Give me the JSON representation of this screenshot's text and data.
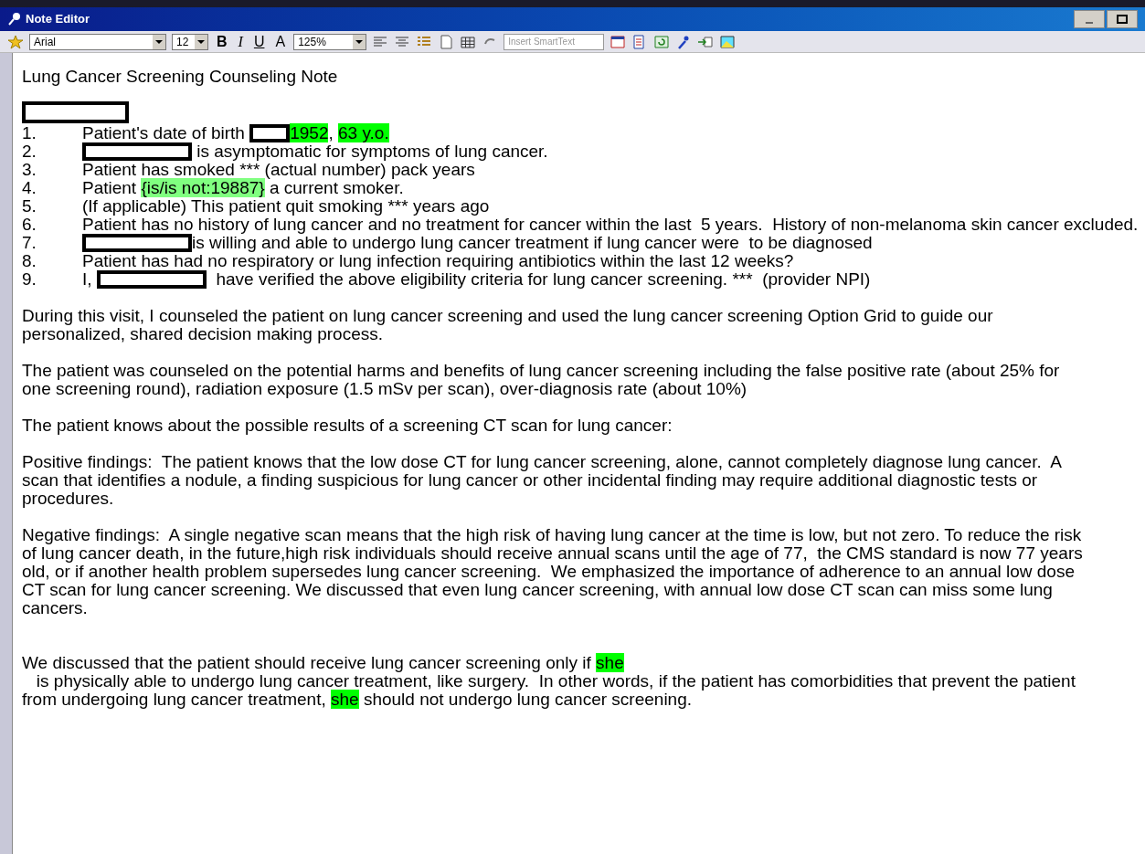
{
  "window": {
    "title": "Note Editor"
  },
  "toolbar": {
    "font": "Arial",
    "size": "12",
    "format_buttons": [
      "B",
      "I",
      "U",
      "A"
    ],
    "zoom": "125%",
    "smarttext_placeholder": "Insert SmartText"
  },
  "document": {
    "title": "Lung Cancer Screening Counseling Note",
    "items": [
      {
        "number": "1.",
        "segments": [
          {
            "kind": "text",
            "text": "Patient's date of birth "
          },
          {
            "kind": "redacted"
          },
          {
            "kind": "highlight",
            "text": "1952",
            "color": "#00ff00"
          },
          {
            "kind": "text",
            "text": ", "
          },
          {
            "kind": "highlight",
            "text": "63 y.o.",
            "color": "#00ff00"
          }
        ]
      },
      {
        "number": "2.",
        "segments": [
          {
            "kind": "redacted"
          },
          {
            "kind": "text",
            "text": " is asymptomatic for symptoms of lung cancer."
          }
        ]
      },
      {
        "number": "3.",
        "segments": [
          {
            "kind": "text",
            "text": "Patient has smoked *** (actual number) pack years"
          }
        ]
      },
      {
        "number": "4.",
        "segments": [
          {
            "kind": "text",
            "text": "Patient "
          },
          {
            "kind": "highlight",
            "text": "{is/is not:19887}",
            "color": "#80ff80"
          },
          {
            "kind": "text",
            "text": " a current smoker."
          }
        ]
      },
      {
        "number": "5.",
        "segments": [
          {
            "kind": "text",
            "text": "(If applicable) This patient quit smoking *** years ago"
          }
        ]
      },
      {
        "number": "6.",
        "segments": [
          {
            "kind": "text",
            "text": "Patient has no history of lung cancer and no treatment for cancer within the last  5 years.  History of non-melanoma skin cancer excluded."
          }
        ]
      },
      {
        "number": "7.",
        "segments": [
          {
            "kind": "redacted"
          },
          {
            "kind": "text",
            "text": "is willing and able to undergo lung cancer treatment if lung cancer were  to be diagnosed"
          }
        ]
      },
      {
        "number": "8.",
        "segments": [
          {
            "kind": "text",
            "text": "Patient has had no respiratory or lung infection requiring antibiotics within the last 12 weeks?"
          }
        ]
      },
      {
        "number": "9.",
        "segments": [
          {
            "kind": "text",
            "text": "I, "
          },
          {
            "kind": "redacted"
          },
          {
            "kind": "text",
            "text": "  have verified the above eligibility criteria for lung cancer screening. ***  (provider NPI)"
          }
        ]
      }
    ],
    "paragraphs": [
      {
        "lines": [
          [
            {
              "kind": "text",
              "text": "During this visit, I counseled the patient on lung cancer screening and used the lung cancer screening Option Grid to guide our"
            }
          ],
          [
            {
              "kind": "text",
              "text": "personalized, shared decision making process."
            }
          ]
        ]
      },
      {
        "lines": [
          [
            {
              "kind": "text",
              "text": "The patient was counseled on the potential harms and benefits of lung cancer screening including the false positive rate (about 25% for"
            }
          ],
          [
            {
              "kind": "text",
              "text": "one screening round), radiation exposure (1.5 mSv per scan), over-diagnosis rate (about 10%)"
            }
          ]
        ]
      },
      {
        "lines": [
          [
            {
              "kind": "text",
              "text": "The patient knows about the possible results of a screening CT scan for lung cancer:"
            }
          ]
        ]
      },
      {
        "lines": [
          [
            {
              "kind": "text",
              "text": "Positive findings:  The patient knows that the low dose CT for lung cancer screening, alone, cannot completely diagnose lung cancer.  A"
            }
          ],
          [
            {
              "kind": "text",
              "text": "scan that identifies a nodule, a finding suspicious for lung cancer or other incidental finding may require additional diagnostic tests or"
            }
          ],
          [
            {
              "kind": "text",
              "text": "procedures."
            }
          ]
        ]
      },
      {
        "lines": [
          [
            {
              "kind": "text",
              "text": "Negative findings:  A single negative scan means that the high risk of having lung cancer at the time is low, but not zero. To reduce the risk"
            }
          ],
          [
            {
              "kind": "text",
              "text": "of lung cancer death, in the future,high risk individuals should receive annual scans until the age of 77,  the CMS standard is now 77 years"
            }
          ],
          [
            {
              "kind": "text",
              "text": "old, or if another health problem supersedes lung cancer screening.  We emphasized the importance of adherence to an annual low dose"
            }
          ],
          [
            {
              "kind": "text",
              "text": "CT scan for lung cancer screening. We discussed that even lung cancer screening, with annual low dose CT scan can miss some lung"
            }
          ],
          [
            {
              "kind": "text",
              "text": "cancers."
            }
          ]
        ]
      },
      {
        "lines": [
          [
            {
              "kind": "text",
              "text": "We discussed that the patient should receive lung cancer screening only if "
            },
            {
              "kind": "highlight",
              "text": "she",
              "color": "#00ff00"
            }
          ],
          [
            {
              "kind": "text",
              "text": "   is physically able to undergo lung cancer treatment, like surgery.  In other words, if the patient has comorbidities that prevent the patient"
            }
          ],
          [
            {
              "kind": "text",
              "text": "from undergoing lung cancer treatment, "
            },
            {
              "kind": "highlight",
              "text": "she",
              "color": "#00ff00"
            },
            {
              "kind": "text",
              "text": " should not undergo lung cancer screening."
            }
          ]
        ]
      }
    ]
  }
}
